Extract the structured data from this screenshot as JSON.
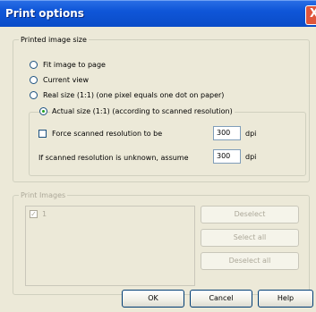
{
  "window": {
    "title": "Print options",
    "close_glyph": "X"
  },
  "printed_image_size": {
    "legend": "Printed image size",
    "options": [
      {
        "label": "Fit image to page",
        "checked": false
      },
      {
        "label": "Current view",
        "checked": false
      },
      {
        "label": "Real size (1:1) (one pixel equals one dot on paper)",
        "checked": false
      }
    ],
    "actual_size": {
      "label": "Actual size (1:1) (according to scanned resolution)",
      "checked": true,
      "force_label": "Force scanned resolution to be",
      "force_value": "300",
      "force_unit": "dpi",
      "unknown_label": "If scanned resolution is unknown, assume",
      "unknown_value": "300",
      "unknown_unit": "dpi"
    }
  },
  "print_images": {
    "legend": "Print Images",
    "items": [
      {
        "label": "1",
        "checked": true
      }
    ],
    "deselect_label": "Deselect",
    "select_all_label": "Select all",
    "deselect_all_label": "Deselect all"
  },
  "footer": {
    "ok_label": "OK",
    "cancel_label": "Cancel",
    "help_label": "Help"
  }
}
